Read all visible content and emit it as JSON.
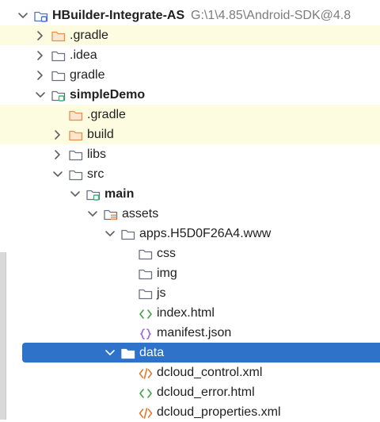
{
  "tree": [
    {
      "label": "HBuilder-Integrate-AS",
      "path": "G:\\1\\4.85\\Android-SDK@4.8",
      "icon": "project-module-icon",
      "chevron": "down",
      "depth": 0,
      "bold": true
    },
    {
      "label": ".gradle",
      "icon": "folder-orange-icon",
      "chevron": "right",
      "depth": 1,
      "highlight": true
    },
    {
      "label": ".idea",
      "icon": "folder-icon",
      "chevron": "right",
      "depth": 1
    },
    {
      "label": "gradle",
      "icon": "folder-icon",
      "chevron": "right",
      "depth": 1
    },
    {
      "label": "simpleDemo",
      "icon": "module-folder-icon",
      "chevron": "down",
      "depth": 1,
      "bold": true
    },
    {
      "label": ".gradle",
      "icon": "folder-orange-icon",
      "chevron": "none",
      "depth": 2,
      "highlight": true
    },
    {
      "label": "build",
      "icon": "folder-orange-icon",
      "chevron": "right",
      "depth": 2,
      "highlight": true
    },
    {
      "label": "libs",
      "icon": "folder-icon",
      "chevron": "right",
      "depth": 2
    },
    {
      "label": "src",
      "icon": "folder-icon",
      "chevron": "down",
      "depth": 2
    },
    {
      "label": "main",
      "icon": "module-folder-icon",
      "chevron": "down",
      "depth": 3,
      "bold": true
    },
    {
      "label": "assets",
      "icon": "resources-folder-icon",
      "chevron": "down",
      "depth": 4
    },
    {
      "label": "apps.H5D0F26A4.www",
      "icon": "folder-icon",
      "chevron": "down",
      "depth": 5
    },
    {
      "label": "css",
      "icon": "folder-icon",
      "chevron": "none",
      "depth": 6
    },
    {
      "label": "img",
      "icon": "folder-icon",
      "chevron": "none",
      "depth": 6
    },
    {
      "label": "js",
      "icon": "folder-icon",
      "chevron": "none",
      "depth": 6
    },
    {
      "label": "index.html",
      "icon": "html-file-icon",
      "chevron": "none",
      "depth": 6
    },
    {
      "label": "manifest.json",
      "icon": "json-file-icon",
      "chevron": "none",
      "depth": 6
    },
    {
      "label": "data",
      "icon": "folder-icon",
      "chevron": "down",
      "depth": 5,
      "selected": true
    },
    {
      "label": "dcloud_control.xml",
      "icon": "xml-file-icon",
      "chevron": "none",
      "depth": 6
    },
    {
      "label": "dcloud_error.html",
      "icon": "html-file-icon",
      "chevron": "none",
      "depth": 6
    },
    {
      "label": "dcloud_properties.xml",
      "icon": "xml-file-icon",
      "chevron": "none",
      "depth": 6
    }
  ],
  "colors": {
    "selection": "#2e72c9",
    "excluded_highlight": "#fdfbe0",
    "folder_stroke": "#6c707e",
    "folder_orange": "#e5914a",
    "module_badge": "#3fb37a",
    "html_icon": "#3fa14c",
    "xml_icon": "#e07a2d",
    "json_icon": "#9a5fd3"
  }
}
